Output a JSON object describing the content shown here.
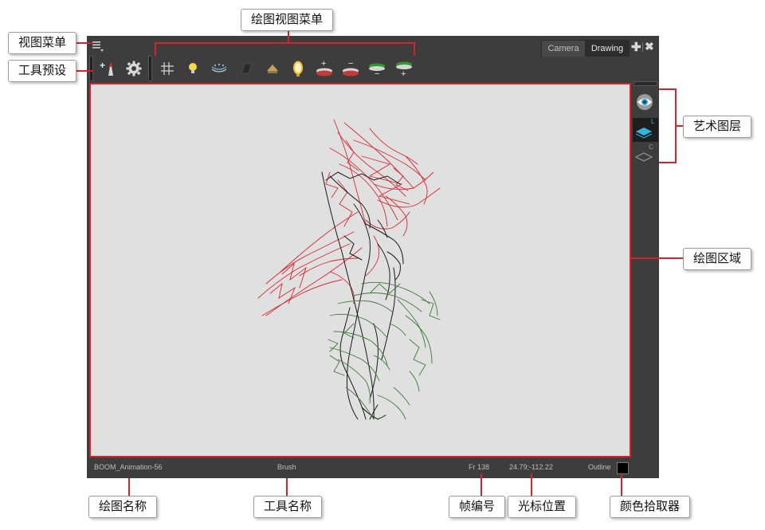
{
  "window": {
    "tabs": [
      {
        "label": "Camera",
        "active": false
      },
      {
        "label": "Drawing",
        "active": true
      }
    ],
    "add_icon": "plus-icon",
    "close_icon": "close-icon"
  },
  "toolbar": {
    "view_menu_icon": "hamburger-menu-icon",
    "preset_icons": [
      "add-tool-preset-icon",
      "tool-properties-gear-icon"
    ],
    "drawing_view_icons": [
      "grid-icon",
      "light-table-icon",
      "onion-skin-icon",
      "shade-icon",
      "preview-icon",
      "mirror-icon",
      "add-colour-icon",
      "remove-colour-icon",
      "add-layer-below-icon",
      "add-layer-above-icon"
    ]
  },
  "sidebar": {
    "layers": [
      {
        "icon": "eye-icon",
        "label": ""
      },
      {
        "icon": "layer-line-art-icon",
        "label": "L"
      },
      {
        "icon": "layer-colour-art-icon",
        "label": "C"
      }
    ]
  },
  "status": {
    "drawing_name": "BOOM_Animation-56",
    "tool_name": "Brush",
    "frame": "Fr 138",
    "cursor": "24.79;-112.22",
    "mode": "Outline",
    "colour_swatch": "#000000"
  },
  "callouts": {
    "view_menu": "视图菜单",
    "tool_presets": "工具预设",
    "drawing_view_menu": "绘图视图菜单",
    "art_layers": "艺术图层",
    "drawing_area": "绘图区域",
    "drawing_name": "绘图名称",
    "tool_name": "工具名称",
    "frame_number": "帧编号",
    "cursor_position": "光标位置",
    "colour_picker": "颜色拾取器"
  },
  "colors": {
    "callout_line": "#d6232a",
    "panel": "#3d3d3d",
    "canvas": "#e0e0e0",
    "line_art": "#c8202a",
    "colour_art": "#3f7a3a",
    "ink": "#1a1a1a"
  }
}
